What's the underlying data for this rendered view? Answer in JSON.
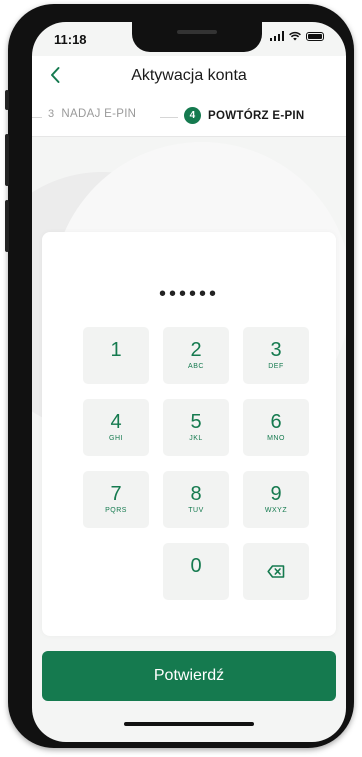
{
  "status_bar": {
    "time": "11:18"
  },
  "header": {
    "title": "Aktywacja konta",
    "back_icon": "chevron-left-icon"
  },
  "steps": [
    {
      "number": "3",
      "label": "NADAJ E-PIN",
      "active": false
    },
    {
      "number": "4",
      "label": "POWTÓRZ E-PIN",
      "active": true
    }
  ],
  "pin": {
    "masked": "••••••"
  },
  "keypad": [
    {
      "digit": "1",
      "letters": ""
    },
    {
      "digit": "2",
      "letters": "ABC"
    },
    {
      "digit": "3",
      "letters": "DEF"
    },
    {
      "digit": "4",
      "letters": "GHI"
    },
    {
      "digit": "5",
      "letters": "JKL"
    },
    {
      "digit": "6",
      "letters": "MNO"
    },
    {
      "digit": "7",
      "letters": "PQRS"
    },
    {
      "digit": "8",
      "letters": "TUV"
    },
    {
      "digit": "9",
      "letters": "WXYZ"
    },
    {
      "digit": "0",
      "letters": ""
    }
  ],
  "delete_key": {
    "icon": "backspace-icon"
  },
  "confirm_button": {
    "label": "Potwierdź"
  },
  "colors": {
    "accent": "#157a4f",
    "key_bg": "#f2f3f2",
    "screen_bg": "#f4f5f4"
  }
}
